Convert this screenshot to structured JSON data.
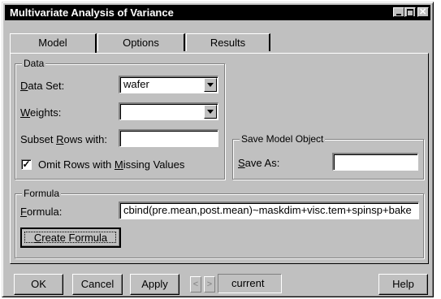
{
  "window": {
    "title": "Multivariate Analysis of Variance"
  },
  "tabs": [
    {
      "label": "Model",
      "active": true
    },
    {
      "label": "Options",
      "active": false
    },
    {
      "label": "Results",
      "active": false
    }
  ],
  "data_group": {
    "legend": "Data",
    "data_set_label": "Data Set:",
    "data_set_value": "wafer",
    "weights_label": "Weights:",
    "weights_value": "",
    "subset_label": "Subset Rows with:",
    "subset_value": "",
    "omit_label": "Omit Rows with Missing Values",
    "omit_checked": true
  },
  "save_group": {
    "legend": "Save Model Object",
    "save_as_label": "Save As:",
    "save_as_value": ""
  },
  "formula_group": {
    "legend": "Formula",
    "formula_label": "Formula:",
    "formula_value": "cbind(pre.mean,post.mean)~maskdim+visc.tem+spinsp+bake",
    "create_button": "Create Formula"
  },
  "footer": {
    "ok": "OK",
    "cancel": "Cancel",
    "apply": "Apply",
    "prev": "<",
    "next": ">",
    "current": "current",
    "help": "Help"
  }
}
